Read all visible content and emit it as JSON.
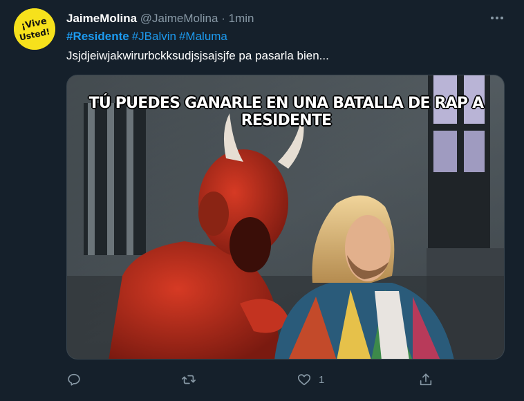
{
  "tweet": {
    "author_name": "JaimeMolina",
    "author_handle": "@JaimeMolina",
    "separator": "·",
    "time": "1min",
    "hashtags": [
      "#Residente",
      "#JBalvin",
      "#Maluma"
    ],
    "text": "Jsjdjeiwjakwirurbckksudjsjsajsjfe pa pasarla bien...",
    "avatar_text": "Vive Usted",
    "image_caption": "TÚ PUEDES GANARLE EN UNA BATALLA DE RAP A RESIDENTE"
  },
  "actions": {
    "reply_icon": "reply-icon",
    "retweet_icon": "retweet-icon",
    "like_icon": "heart-icon",
    "like_count": "1",
    "share_icon": "share-icon"
  },
  "colors": {
    "background": "#15202b",
    "link": "#1d9bf0",
    "muted": "#8899a6",
    "avatar_bg": "#f6e11c"
  }
}
